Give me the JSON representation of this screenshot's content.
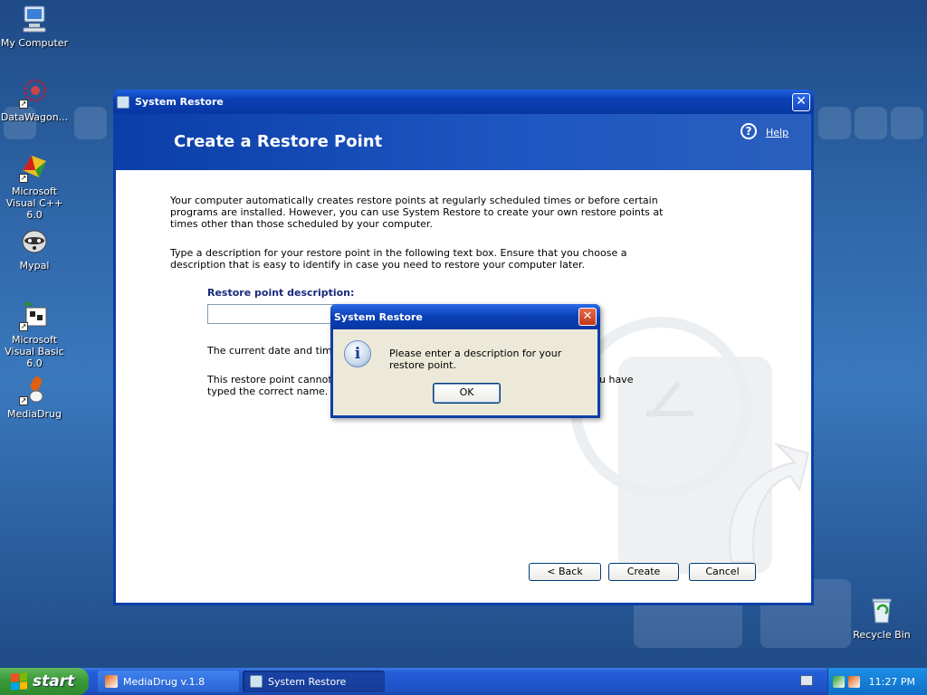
{
  "desktop": {
    "icons": [
      {
        "label": "My Computer",
        "icon": "computer-icon"
      },
      {
        "label": "DataWagon...",
        "icon": "datawagon-icon"
      },
      {
        "label": "Microsoft Visual C++ 6.0",
        "icon": "visual-cpp-icon"
      },
      {
        "label": "Mypal",
        "icon": "mypal-icon"
      },
      {
        "label": "Microsoft Visual Basic 6.0",
        "icon": "visual-basic-icon"
      },
      {
        "label": "MediaDrug",
        "icon": "mediadrug-icon"
      },
      {
        "label": "Recycle Bin",
        "icon": "recycle-bin-icon"
      }
    ]
  },
  "window": {
    "title": "System Restore",
    "close_label": "✕",
    "heading": "Create a Restore Point",
    "help_label": "Help",
    "intro": "Your computer automatically creates restore points at regularly scheduled times or before certain programs are installed. However, you can use System Restore to create your own restore points at times other than those scheduled by your computer.",
    "instructions": "Type a description for your restore point in the following text box. Ensure that you choose a description that is easy to identify in case you need to restore your computer later.",
    "field_label": "Restore point description:",
    "field_value": "",
    "date_note": "The current date and time ar",
    "warning_line1_left": "This restore point cannot be",
    "warning_line1_right": "u have",
    "warning_line2": "typed the correct name.",
    "buttons": {
      "back": "< Back",
      "create": "Create",
      "cancel": "Cancel"
    }
  },
  "dialog": {
    "title": "System Restore",
    "message": "Please enter a description for your restore point.",
    "ok_label": "OK",
    "icon": "info-icon"
  },
  "taskbar": {
    "start_label": "start",
    "tasks": [
      {
        "label": "MediaDrug v.1.8",
        "active": false
      },
      {
        "label": "System Restore",
        "active": true
      }
    ],
    "clock": "11:27 PM"
  },
  "colors": {
    "titlebar": "#0a3fb5",
    "dialog_close": "#c0391b",
    "start_green": "#3a9a38"
  }
}
